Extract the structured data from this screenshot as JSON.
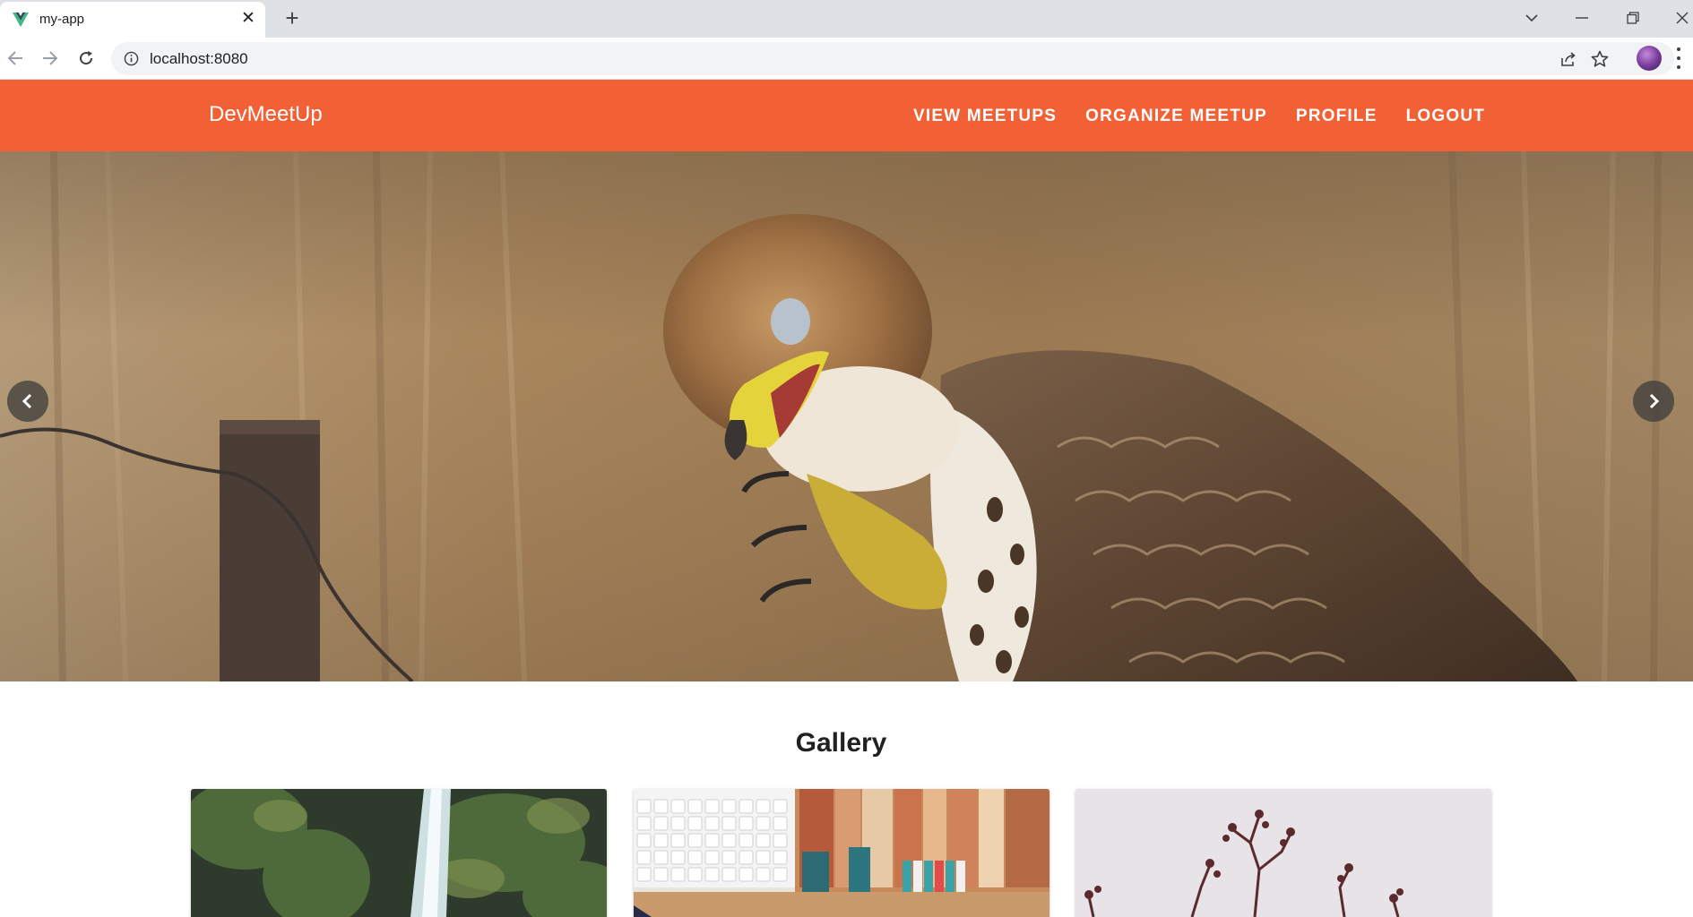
{
  "browser": {
    "tab_title": "my-app",
    "url": "localhost:8080"
  },
  "app": {
    "title": "DevMeetUp",
    "nav": [
      "VIEW MEETUPS",
      "ORGANIZE MEETUP",
      "PROFILE",
      "LOGOUT"
    ],
    "accent_color": "#f26135"
  },
  "carousel": {
    "image": "hawk"
  },
  "gallery": {
    "title": "Gallery",
    "items": [
      "waterfall",
      "keyboard-and-books",
      "branches"
    ]
  }
}
